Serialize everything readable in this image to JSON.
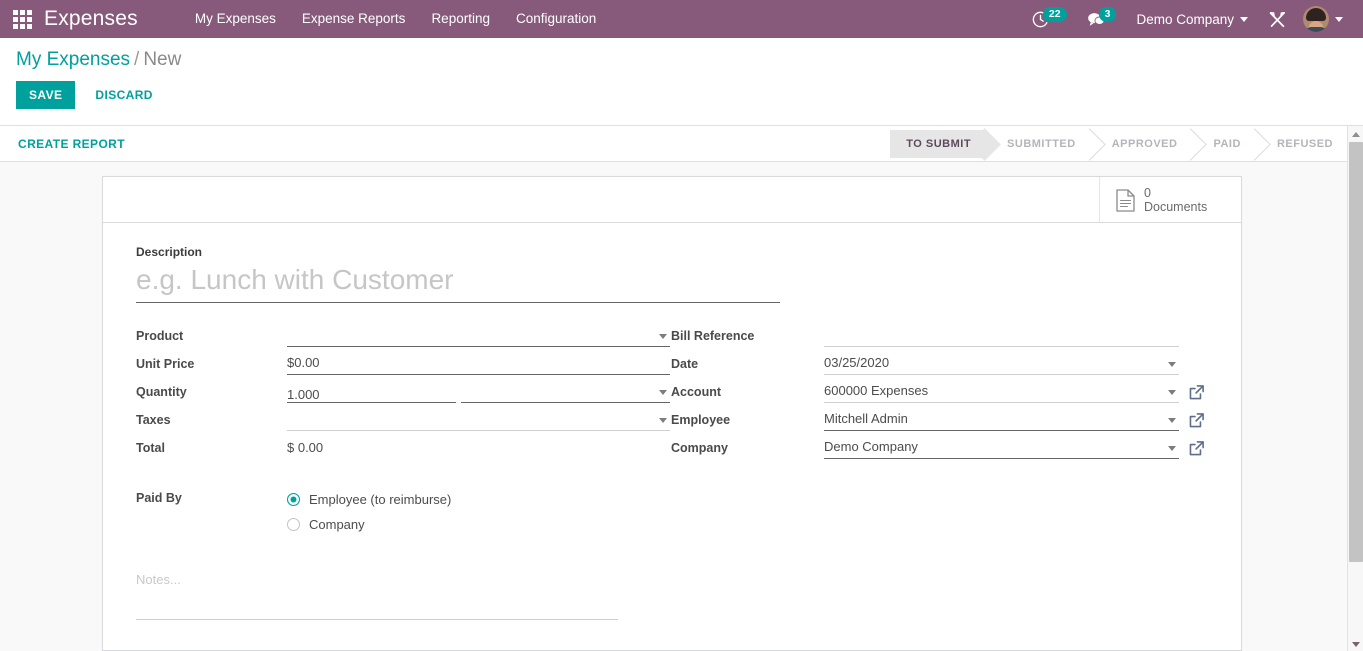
{
  "navbar": {
    "apps_icon": "apps-grid-icon",
    "brand": "Expenses",
    "menus": [
      {
        "label": "My Expenses"
      },
      {
        "label": "Expense Reports"
      },
      {
        "label": "Reporting"
      },
      {
        "label": "Configuration"
      }
    ],
    "activities": {
      "icon": "clock-icon",
      "count": "22"
    },
    "messages": {
      "icon": "chat-bubble-icon",
      "count": "3"
    },
    "company": "Demo Company",
    "debug_icon": "tools-wrench-hammer-icon",
    "avatar": "user-avatar"
  },
  "control_panel": {
    "breadcrumb_root": "My Expenses",
    "breadcrumb_sep": "/",
    "breadcrumb_current": "New",
    "save_label": "SAVE",
    "discard_label": "DISCARD"
  },
  "statusbar": {
    "create_report_label": "CREATE REPORT",
    "stages": [
      {
        "label": "TO SUBMIT",
        "active": true
      },
      {
        "label": "SUBMITTED",
        "active": false
      },
      {
        "label": "APPROVED",
        "active": false
      },
      {
        "label": "PAID",
        "active": false
      },
      {
        "label": "REFUSED",
        "active": false
      }
    ]
  },
  "button_box": {
    "documents": {
      "icon": "document-icon",
      "value": "0",
      "label": "Documents"
    }
  },
  "form": {
    "description": {
      "label": "Description",
      "value": "",
      "placeholder": "e.g. Lunch with Customer"
    },
    "left_fields": [
      {
        "label": "Product",
        "value": "",
        "type": "dropdown",
        "underline": "dark"
      },
      {
        "label": "Unit Price",
        "value": "$0.00",
        "type": "text",
        "underline": "dark"
      },
      {
        "label": "Quantity",
        "value": "1.000",
        "type": "quantity",
        "uom_value": "",
        "underline": "dark"
      },
      {
        "label": "Taxes",
        "value": "",
        "type": "dropdown",
        "underline": "light"
      },
      {
        "label": "Total",
        "value": "$ 0.00",
        "type": "readonly",
        "underline": "none"
      }
    ],
    "right_fields": [
      {
        "label": "Bill Reference",
        "value": "",
        "type": "text",
        "underline": "light",
        "ext_link": false
      },
      {
        "label": "Date",
        "value": "03/25/2020",
        "type": "dropdown",
        "underline": "light",
        "ext_link": false
      },
      {
        "label": "Account",
        "value": "600000 Expenses",
        "type": "dropdown",
        "underline": "light",
        "ext_link": true
      },
      {
        "label": "Employee",
        "value": "Mitchell Admin",
        "type": "dropdown",
        "underline": "dark",
        "ext_link": true
      },
      {
        "label": "Company",
        "value": "Demo Company",
        "type": "dropdown",
        "underline": "dark",
        "ext_link": true
      }
    ],
    "paid_by": {
      "label": "Paid By",
      "options": [
        {
          "label": "Employee (to reimburse)",
          "selected": true
        },
        {
          "label": "Company",
          "selected": false
        }
      ]
    },
    "notes": {
      "value": "",
      "placeholder": "Notes..."
    }
  },
  "colors": {
    "brand_purple": "#875A7B",
    "accent_teal": "#00A09D",
    "active_stage_bg": "#E6E6E6",
    "link_icon": "#5e6e8c"
  }
}
